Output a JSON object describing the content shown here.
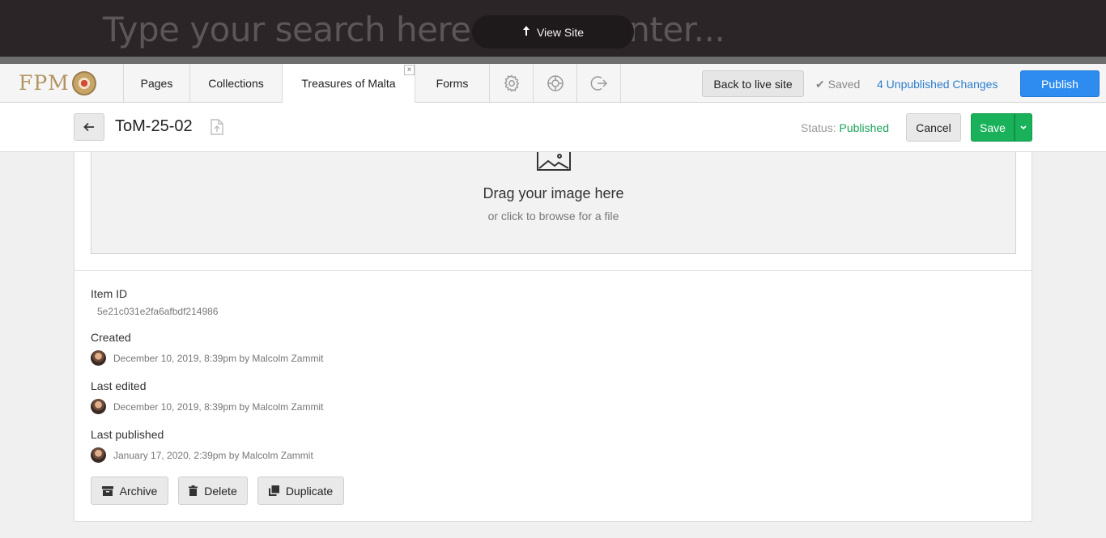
{
  "site_bar": {
    "search_placeholder": "Type your search here and hit enter...",
    "view_site_label": "View Site"
  },
  "nav": {
    "logo_text": "FPM",
    "tabs": [
      {
        "label": "Pages"
      },
      {
        "label": "Collections"
      },
      {
        "label": "Treasures of Malta",
        "active": true
      },
      {
        "label": "Forms"
      }
    ],
    "icon_tabs": [
      "gear-icon",
      "help-lifebuoy-icon",
      "logout-icon"
    ],
    "tab_close_glyph": "×",
    "back_to_live_label": "Back to live site",
    "saved_label": "Saved",
    "unpublished_label": "4 Unpublished Changes",
    "publish_label": "Publish"
  },
  "item": {
    "title": "ToM-25-02",
    "status_label": "Status:",
    "status_value": "Published",
    "cancel_label": "Cancel",
    "save_label": "Save"
  },
  "dropzone": {
    "title": "Drag your image here",
    "subtitle": "or click to browse for a file"
  },
  "meta": {
    "item_id_label": "Item ID",
    "item_id": "5e21c031e2fa6afbdf214986",
    "created_label": "Created",
    "created_value": "December 10, 2019, 8:39pm by Malcolm Zammit",
    "last_edited_label": "Last edited",
    "last_edited_value": "December 10, 2019, 8:39pm by Malcolm Zammit",
    "last_published_label": "Last published",
    "last_published_value": "January 17, 2020, 2:39pm by Malcolm Zammit"
  },
  "actions": {
    "archive_label": "Archive",
    "delete_label": "Delete",
    "duplicate_label": "Duplicate"
  },
  "colors": {
    "publish_blue": "#2e8cf0",
    "save_green": "#19b15a",
    "status_green": "#1aa35b",
    "link_blue": "#2d7fcf",
    "site_bar_dark": "#2b2527"
  }
}
